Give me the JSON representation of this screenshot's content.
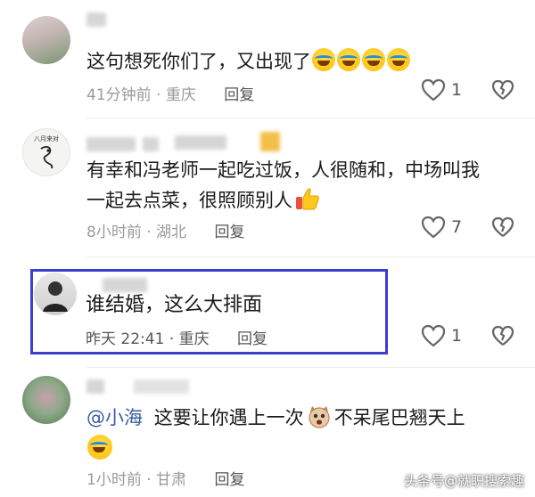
{
  "comments": [
    {
      "text_parts": [
        "这句想死你们了，又出现了"
      ],
      "time": "41分钟前",
      "location": "重庆",
      "reply_label": "回复",
      "like_count": "1"
    },
    {
      "line1": "有幸和冯老师一起吃过饭，人很随和，中场叫我",
      "line2": "一起去点菜，很照顾别人",
      "avatar_text": "八月来对",
      "time": "8小时前",
      "location": "湖北",
      "reply_label": "回复",
      "like_count": "7"
    },
    {
      "text": "谁结婚，这么大排面",
      "time": "昨天 22:41",
      "location": "重庆",
      "reply_label": "回复",
      "like_count": "1"
    },
    {
      "mention": "@小海",
      "text_mid": "这要让你遇上一次",
      "text_end": "不呆尾巴翘天上",
      "time": "1小时前",
      "location": "甘肃",
      "reply_label": "回复"
    }
  ],
  "meta_separator": "·",
  "watermark": "头条号@就职搜索趣",
  "colors": {
    "highlight_border": "#3b3fd0",
    "mention": "#3a5f9f",
    "meta": "#9a9a9a"
  }
}
